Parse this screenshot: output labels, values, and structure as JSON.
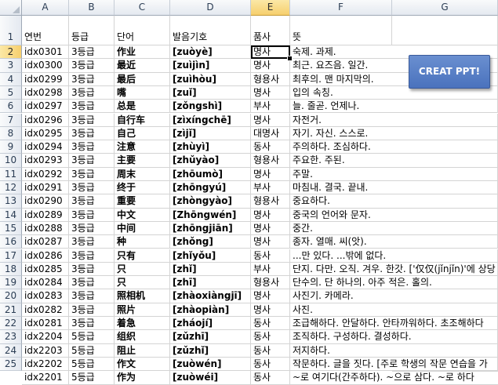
{
  "columns": [
    "A",
    "B",
    "C",
    "D",
    "E",
    "F",
    "G"
  ],
  "row_numbers": [
    "1",
    "2",
    "3",
    "4",
    "5",
    "6",
    "7",
    "8",
    "9",
    "10",
    "11",
    "12",
    "13",
    "14",
    "15",
    "16",
    "17",
    "18",
    "19",
    "20",
    "21",
    "22",
    "23",
    "24",
    "25"
  ],
  "header_row": [
    "연번",
    "등급",
    "단어",
    "발음기호",
    "품사",
    "뜻",
    ""
  ],
  "rows": [
    [
      "idx0301",
      "3등급",
      "作业",
      "[zuòyè]",
      "명사",
      "숙제. 과제."
    ],
    [
      "idx0300",
      "3등급",
      "最近",
      "[zuìjìn]",
      "명사",
      "최근. 요즈음. 일간."
    ],
    [
      "idx0299",
      "3등급",
      "最后",
      "[zuìhòu]",
      "형용사",
      "최후의. 맨 마지막의."
    ],
    [
      "idx0298",
      "3등급",
      "嘴",
      "[zuǐ]",
      "명사",
      "입의 속칭."
    ],
    [
      "idx0297",
      "3등급",
      "总是",
      "[zǒngshì]",
      "부사",
      "늘. 줄곧. 언제나."
    ],
    [
      "idx0296",
      "3등급",
      "自行车",
      "[zìxíngchē]",
      "명사",
      "자전거."
    ],
    [
      "idx0295",
      "3등급",
      "自己",
      "[zìjǐ]",
      "대명사",
      "자기. 자신. 스스로."
    ],
    [
      "idx0294",
      "3등급",
      "注意",
      "[zhùyì]",
      "동사",
      "주의하다. 조심하다."
    ],
    [
      "idx0293",
      "3등급",
      "主要",
      "[zhǔyào]",
      "형용사",
      "주요한. 주된."
    ],
    [
      "idx0292",
      "3등급",
      "周末",
      "[zhōumò]",
      "명사",
      "주말."
    ],
    [
      "idx0291",
      "3등급",
      "终于",
      "[zhōngyú]",
      "부사",
      "마침내. 결국. 끝내."
    ],
    [
      "idx0290",
      "3등급",
      "重要",
      "[zhòngyào]",
      "형용사",
      "중요하다."
    ],
    [
      "idx0289",
      "3등급",
      "中文",
      "[Zhōngwén]",
      "명사",
      "중국의 언어와 문자."
    ],
    [
      "idx0288",
      "3등급",
      "中间",
      "[zhōngjiān]",
      "명사",
      "중간."
    ],
    [
      "idx0287",
      "3등급",
      "种",
      "[zhǒng]",
      "명사",
      "종자. 열매. 씨(앗)."
    ],
    [
      "idx0286",
      "3등급",
      "只有",
      "[zhǐyǒu]",
      "동사",
      "...만 있다. ...밖에 없다."
    ],
    [
      "idx0285",
      "3등급",
      "只",
      "[zhǐ]",
      "부사",
      "단지. 다만. 오직. 겨우. 한갓. ['仅仅(jǐnjǐn)'에 상당"
    ],
    [
      "idx0284",
      "3등급",
      "只",
      "[zhī]",
      "형용사",
      "단수의. 단 하나의. 아주 적은. 홀의."
    ],
    [
      "idx0283",
      "3등급",
      "照相机",
      "[zhàoxiàngjī]",
      "명사",
      "사진기. 카메라."
    ],
    [
      "idx0282",
      "3등급",
      "照片",
      "[zhàopiàn]",
      "명사",
      "사진."
    ],
    [
      "idx0281",
      "3등급",
      "着急",
      "[zháojí]",
      "동사",
      "조급해하다. 안달하다. 안타까워하다. 초조해하다"
    ],
    [
      "idx2204",
      "5등급",
      "组织",
      "[zǔzhī]",
      "동사",
      "조직하다. 구성하다. 결성하다."
    ],
    [
      "idx2203",
      "5등급",
      "阻止",
      "[zǔzhǐ]",
      "동사",
      "저지하다."
    ],
    [
      "idx2202",
      "5등급",
      "作文",
      "[zuòwén]",
      "동사",
      "작문하다. 글을 짓다. [주로 학생의 작문 연습을 가"
    ],
    [
      "idx2201",
      "5등급",
      "作为",
      "[zuòwéi]",
      "동사",
      "~로 여기다(간주하다). ~으로 삼다. ~로 하다"
    ]
  ],
  "selected_cell": "E2",
  "button": {
    "label": "CREAT PPT!",
    "color": "#4a72bd"
  },
  "colors": {
    "header_bg": "#e4e9f0",
    "active_header_bg": "#f6cf6d",
    "gridline": "#d4d4d4"
  }
}
